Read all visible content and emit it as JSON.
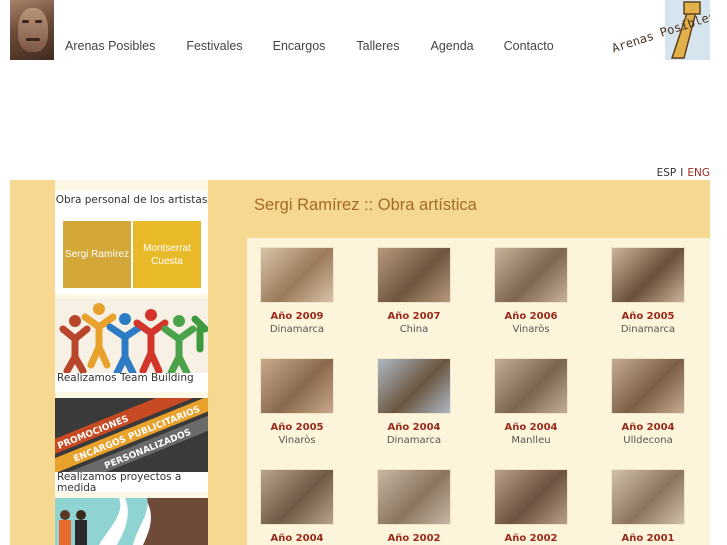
{
  "header": {
    "nav": [
      {
        "label": "Arenas Posibles"
      },
      {
        "label": "Festivales"
      },
      {
        "label": "Encargos"
      },
      {
        "label": "Talleres"
      },
      {
        "label": "Agenda"
      },
      {
        "label": "Contacto"
      }
    ],
    "logo_text": "Arenas Posibles"
  },
  "lang": {
    "esp": "ESP",
    "sep": "I",
    "eng": "ENG"
  },
  "sidebar": {
    "box_title": "Obra personal de los artistas",
    "artist1": "Sergi Ramírez",
    "artist2": "Montserrat Cuesta",
    "promo1": "Realizamos Team Building",
    "promo2": "Realizamos proyectos a medida",
    "promo2_banner": [
      "PROMOCIONES",
      "ENCARGOS PUBLICITARIOS",
      "PERSONALIZADOS"
    ]
  },
  "content": {
    "title": "Sergi Ramírez :: Obra artística",
    "works": [
      {
        "year": "Año 2009",
        "place": "Dinamarca"
      },
      {
        "year": "Año 2007",
        "place": "China"
      },
      {
        "year": "Año 2006",
        "place": "Vinaròs"
      },
      {
        "year": "Año 2005",
        "place": "Dinamarca"
      },
      {
        "year": "Año 2005",
        "place": "Vinaròs"
      },
      {
        "year": "Año 2004",
        "place": "Dinamarca"
      },
      {
        "year": "Año 2004",
        "place": "Manlleu"
      },
      {
        "year": "Año 2004",
        "place": "Ulldecona"
      },
      {
        "year": "Año 2004",
        "place": ""
      },
      {
        "year": "Año 2002",
        "place": ""
      },
      {
        "year": "Año 2002",
        "place": ""
      },
      {
        "year": "Año 2001",
        "place": ""
      }
    ]
  },
  "colors": {
    "accent": "#9b2a1a",
    "band": "#f7d891",
    "artist1": "#d3a838",
    "artist2": "#e8b928"
  }
}
